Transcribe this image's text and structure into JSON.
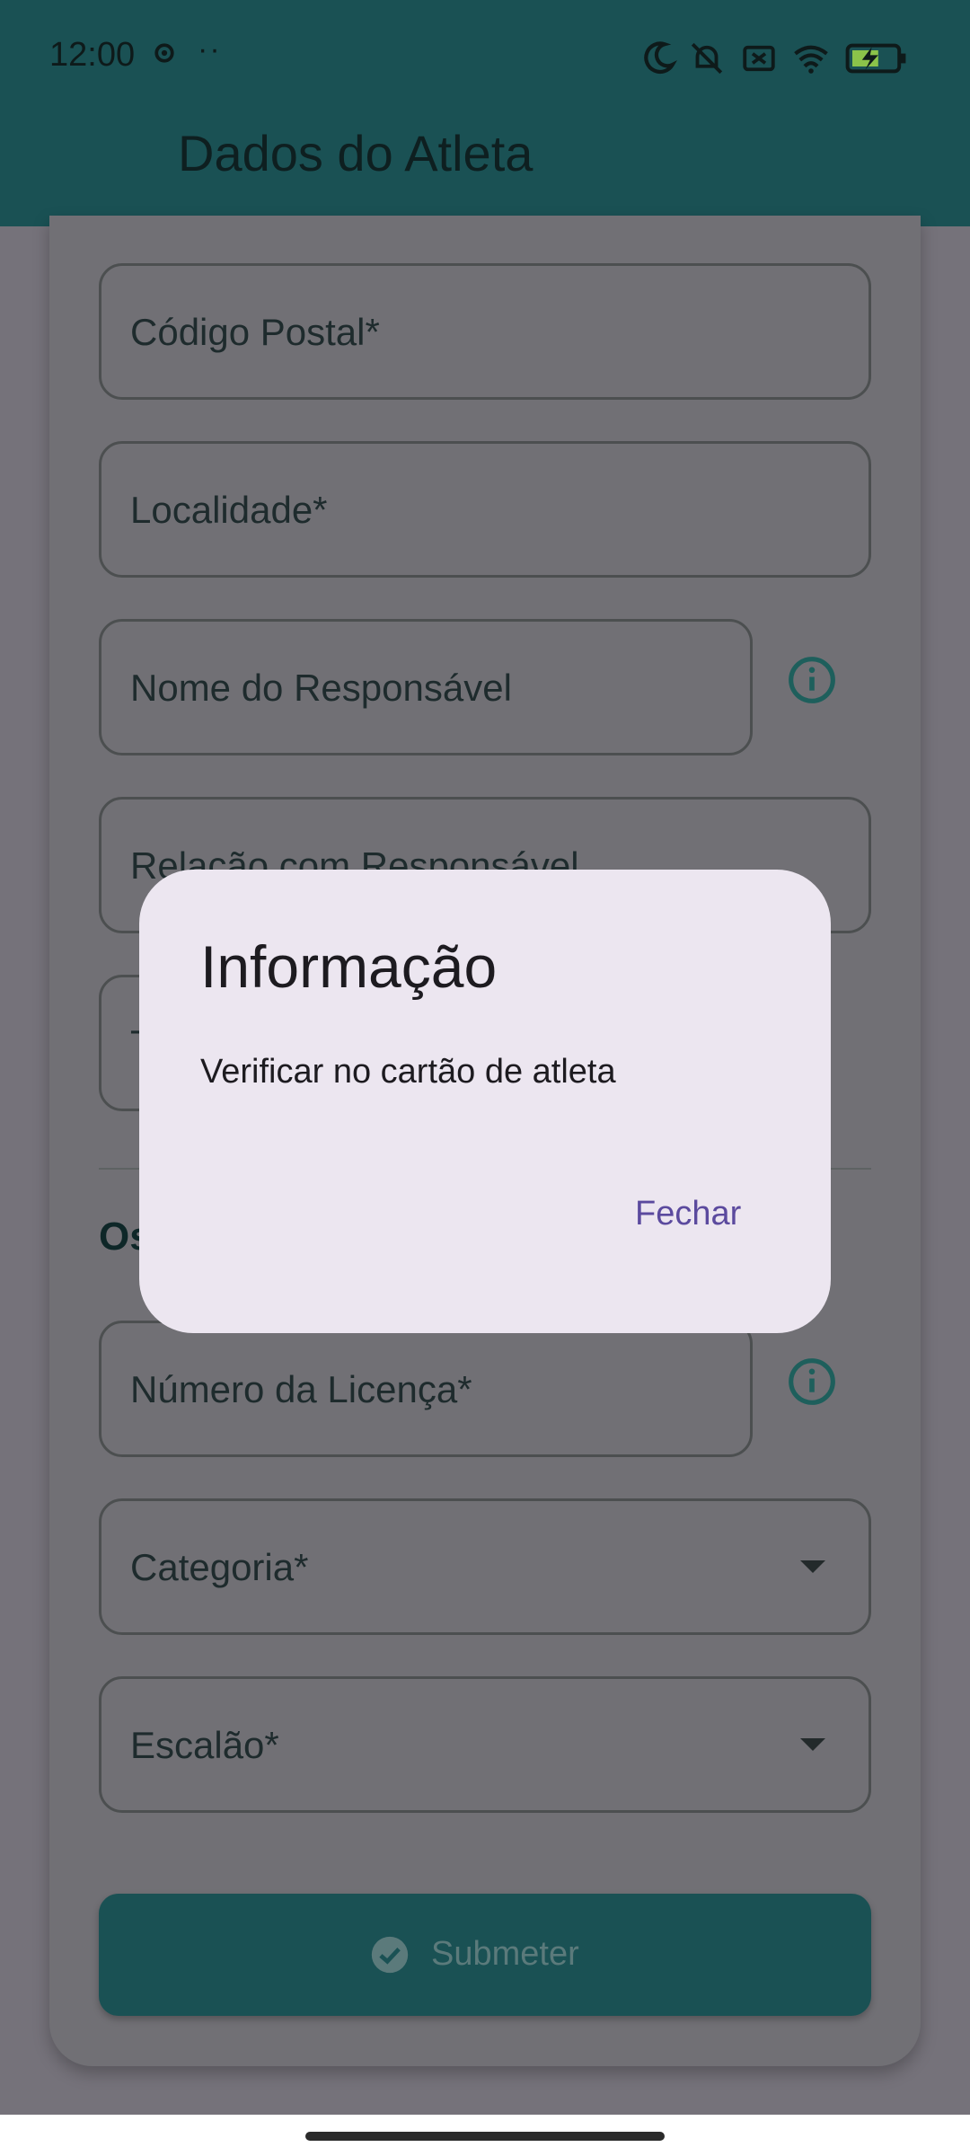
{
  "status_bar": {
    "time": "12:00",
    "dots": "··",
    "icons": [
      "settings-icon",
      "moon-icon",
      "bell-off-icon",
      "no-sim-icon",
      "wifi-icon",
      "battery-charging-icon"
    ]
  },
  "app_bar": {
    "title": "Dados do Atleta",
    "back_icon": "arrow-back-icon"
  },
  "form": {
    "postal_code": {
      "label": "Código Postal*"
    },
    "locality": {
      "label": "Localidade*"
    },
    "guardian_name": {
      "label": "Nome do Responsável",
      "info_icon": "info-icon"
    },
    "guardian_relation": {
      "label": "Relação com Responsável"
    },
    "partial_field": {
      "label": "T"
    },
    "section_title": "Os",
    "license_number": {
      "label": "Número da Licença*",
      "info_icon": "info-icon"
    },
    "category": {
      "label": "Categoria*"
    },
    "tier": {
      "label": "Escalão*"
    },
    "submit_label": "Submeter"
  },
  "dialog": {
    "title": "Informação",
    "body": "Verificar no cartão de atleta",
    "close_label": "Fechar"
  },
  "colors": {
    "app_bar": "#1a5154",
    "scrim_background": "#75727a",
    "dialog_background": "#ece6f0",
    "dialog_accent": "#5b4a9e"
  }
}
